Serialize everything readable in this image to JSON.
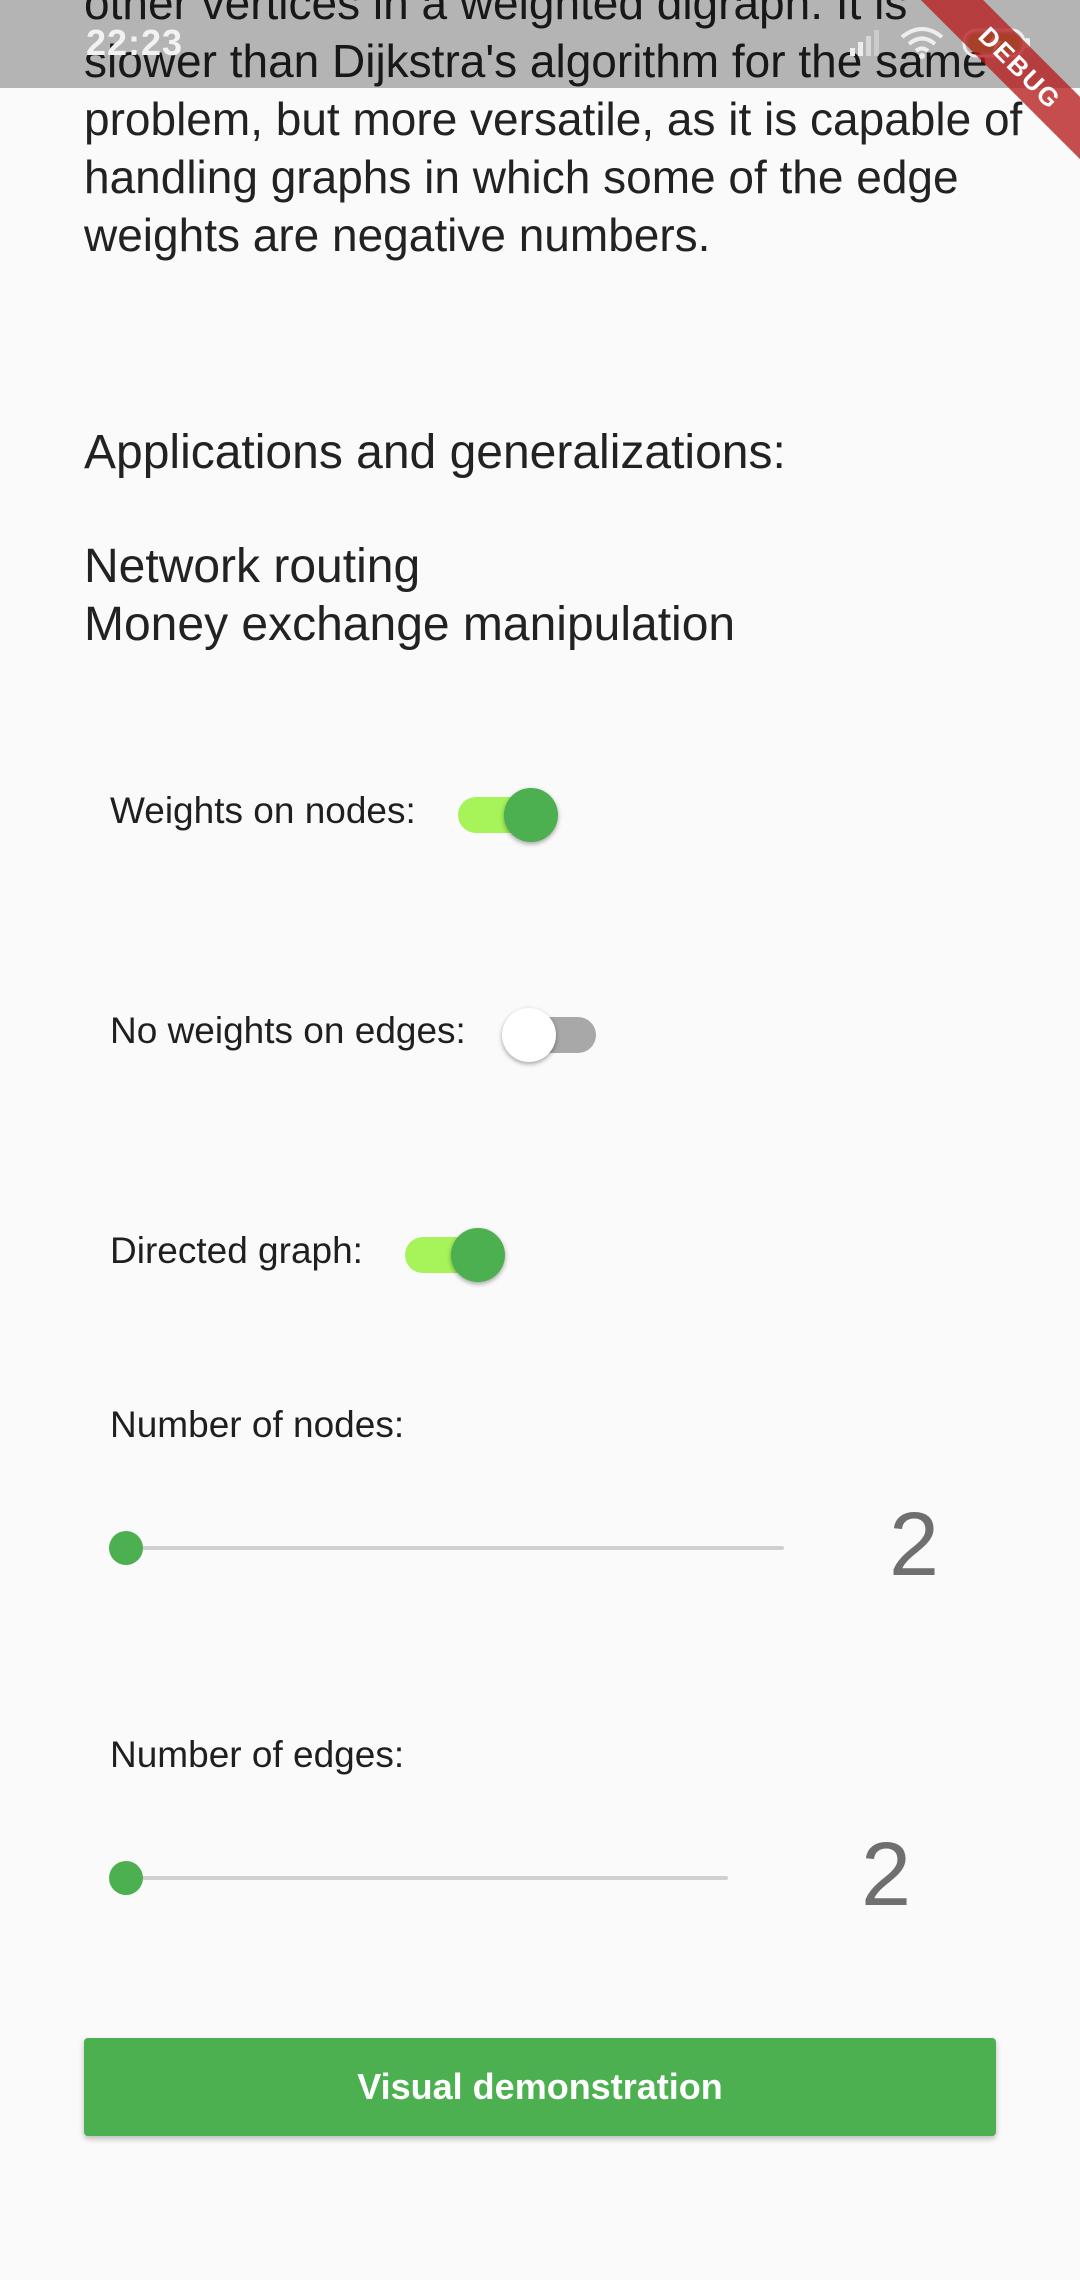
{
  "status_bar": {
    "time": "22:23",
    "icons": [
      "signal-icon",
      "wifi-icon",
      "battery-charging-icon"
    ]
  },
  "debug_banner": {
    "label": "DEBUG"
  },
  "description": {
    "text": "other vertices in a weighted digraph. It is slower than Dijkstra's algorithm for the same problem, but more versatile, as it is capable of handling graphs in which some of the edge weights are negative numbers."
  },
  "applications": {
    "heading": "Applications and generalizations:",
    "items": [
      "Network routing",
      "Money exchange manipulation"
    ]
  },
  "options": {
    "weights_on_nodes": {
      "label": "Weights on nodes:",
      "enabled": true
    },
    "no_weights_on_edges": {
      "label": "No weights on edges:",
      "enabled": false
    },
    "directed_graph": {
      "label": "Directed graph:",
      "enabled": true
    }
  },
  "sliders": {
    "nodes": {
      "label": "Number of nodes:",
      "value": "2",
      "fraction": 0
    },
    "edges": {
      "label": "Number of edges:",
      "value": "2",
      "fraction": 0
    }
  },
  "actions": {
    "demo_button_label": "Visual demonstration"
  },
  "colors": {
    "accent": "#4caf50",
    "switch_track_on": "#a6f35a",
    "switch_track_off": "#a8a8a8",
    "background": "#fafafa"
  }
}
